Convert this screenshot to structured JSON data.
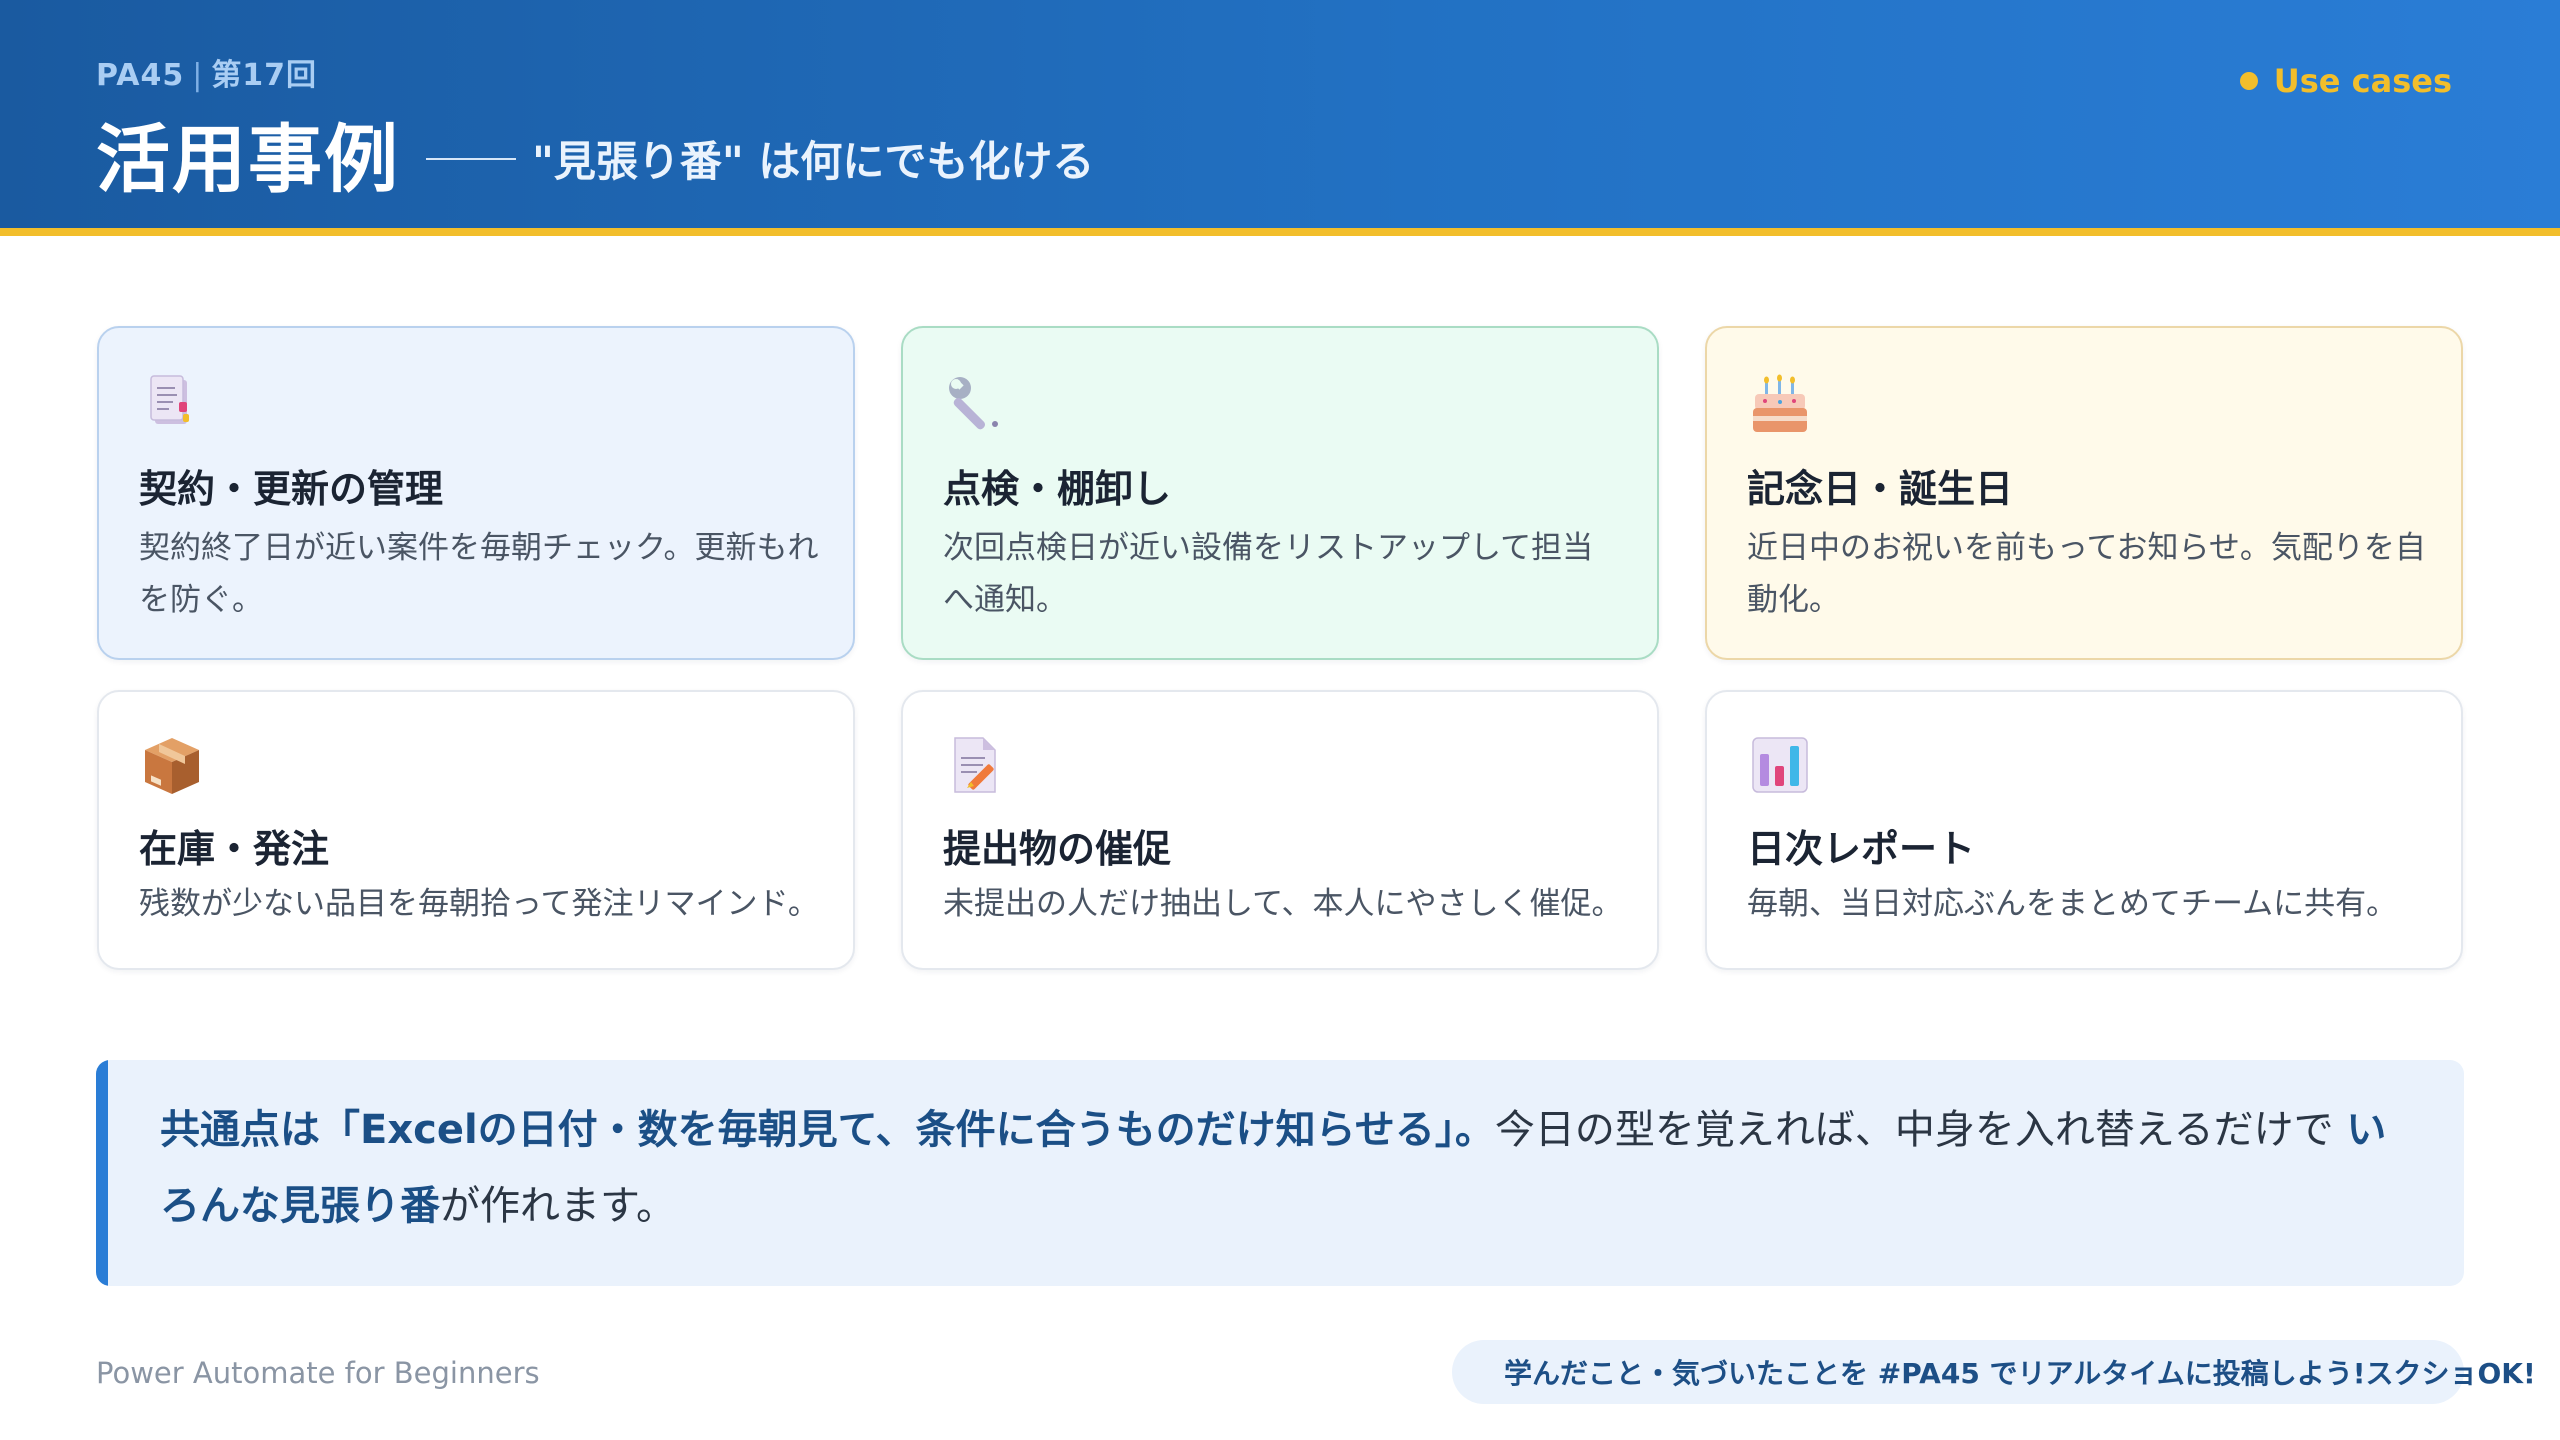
{
  "header": {
    "kicker_code": "PA45",
    "kicker_separator": "|",
    "kicker_session": "第17回",
    "title": "活用事例",
    "subtitle": "\"見張り番\" は何にでも化ける",
    "tag_label": "Use cases",
    "tag_icon": "bullet-dot-icon"
  },
  "cards": [
    {
      "icon": "contract-document-icon",
      "title": "契約・更新の管理",
      "desc": "契約終了日が近い案件を毎朝チェック。更新もれを防ぐ。"
    },
    {
      "icon": "wrench-icon",
      "title": "点検・棚卸し",
      "desc": "次回点検日が近い設備をリストアップして担当へ通知。"
    },
    {
      "icon": "birthday-cake-icon",
      "title": "記念日・誕生日",
      "desc": "近日中のお祝いを前もってお知らせ。気配りを自動化。"
    },
    {
      "icon": "package-box-icon",
      "title": "在庫・発注",
      "desc": "残数が少ない品目を毎朝拾って発注リマインド。"
    },
    {
      "icon": "memo-pencil-icon",
      "title": "提出物の催促",
      "desc": "未提出の人だけ抽出して、本人にやさしく催促。"
    },
    {
      "icon": "bar-chart-icon",
      "title": "日次レポート",
      "desc": "毎朝、当日対応ぶんをまとめてチームに共有。"
    }
  ],
  "callout": {
    "lead_strong": "共通点は「Excelの日付・数を毎朝見て、条件に合うものだけ知らせる」。",
    "middle": "今日の型を覚えれば、中身を入れ替えるだけで ",
    "emph": "いろんな見張り番",
    "tail": "が作れます。"
  },
  "footer": {
    "brand": "Power Automate for Beginners",
    "pill_icon": "speech-bubble-icon",
    "pill_text": "学んだこと・気づいたことを #PA45 でリアルタイムに投稿しよう!スクショOK!"
  },
  "colors": {
    "header_start": "#1a5aa0",
    "header_end": "#2a7dd6",
    "accent_yellow": "#f2be2b",
    "callout_bar": "#2a7dd6"
  }
}
